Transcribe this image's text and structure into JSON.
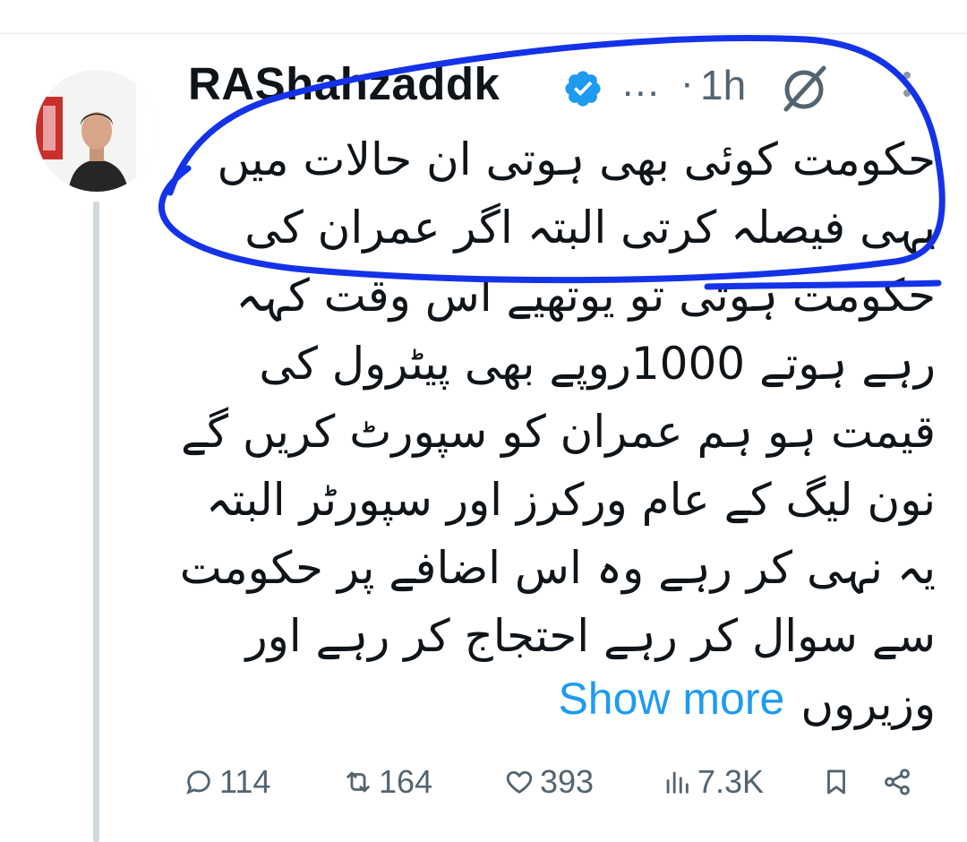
{
  "tweet": {
    "author_name": "RAShahzaddk",
    "ellipsis": "...",
    "separator": "·",
    "timestamp": "1h",
    "lines": [
      "حکومت کوئی بھی ہوتی ان حالات میں",
      "یہی فیصلہ کرتی البتہ اگر عمران کی",
      "حکومت ہوتی تو یوتھیے اس وقت کہہ",
      "رہے ہوتے 1000روپے بھی پیٹرول کی",
      "قیمت ہو ہم عمران کو سپورٹ کریں گے",
      "نون لیگ کے عام ورکرز اور سپورٹر البتہ",
      "یہ نہی کر رہے وہ اس اضافے پر حکومت",
      "سے سوال کر رہے احتجاج کر رہے اور"
    ],
    "last_line": "وزیروں",
    "show_more": "Show more"
  },
  "actions": {
    "replies": "114",
    "reposts": "164",
    "likes": "393",
    "views": "7.3K"
  },
  "icons": {
    "verified": "verified-badge-icon",
    "grok": "grok-icon",
    "more": "more-vertical-icon",
    "reply": "reply-icon",
    "repost": "repost-icon",
    "like": "heart-icon",
    "views": "views-icon",
    "bookmark": "bookmark-icon",
    "share": "share-icon"
  },
  "colors": {
    "accent": "#1d9bf0",
    "secondary_text": "#536471",
    "annotation": "#1433e8"
  }
}
